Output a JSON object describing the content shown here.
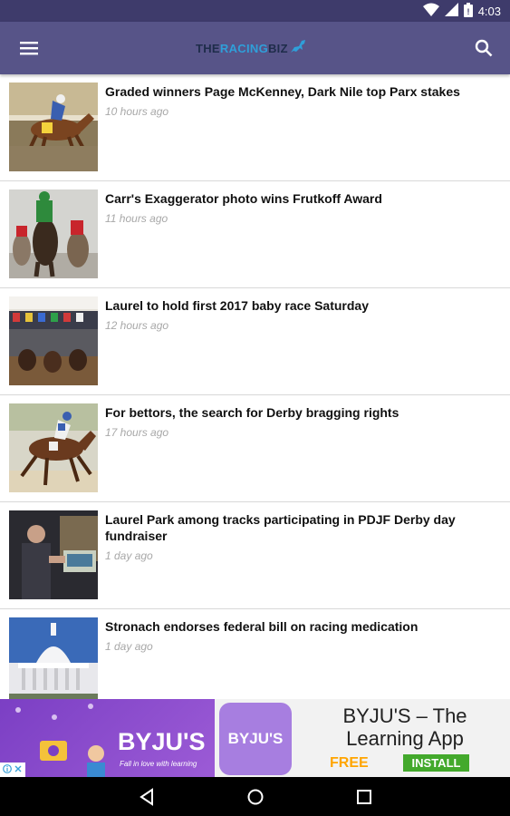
{
  "status_bar": {
    "time": "4:03"
  },
  "toolbar": {
    "logo_part1": "THE",
    "logo_part2": "RACING",
    "logo_part3": "BIZ"
  },
  "articles": [
    {
      "title": "Graded winners Page McKenney, Dark Nile top Parx stakes",
      "time": "10 hours ago"
    },
    {
      "title": "Carr's Exaggerator photo wins Frutkoff Award",
      "time": "11 hours ago"
    },
    {
      "title": "Laurel to hold first 2017 baby race Saturday",
      "time": "12 hours ago"
    },
    {
      "title": "For bettors, the search for Derby bragging rights",
      "time": "17 hours ago"
    },
    {
      "title": "Laurel Park among tracks participating in PDJF Derby day fundraiser",
      "time": "1 day ago"
    },
    {
      "title": "Stronach endorses federal bill on racing medication",
      "time": "1 day ago"
    }
  ],
  "ad": {
    "brand": "BYJU'S",
    "logo_text": "BYJU'S",
    "tagline": "Fall in love with learning",
    "title": "BYJU'S – The Learning App",
    "price": "FREE",
    "cta": "INSTALL"
  }
}
